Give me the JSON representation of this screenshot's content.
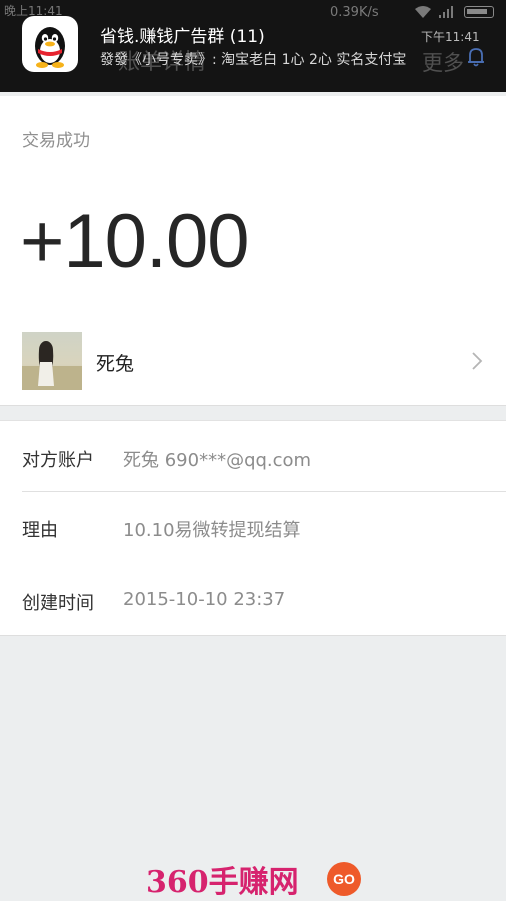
{
  "header": {
    "title": "账单详情",
    "more_label": "更多"
  },
  "statusbar": {
    "time": "晚上11:41",
    "network_speed": "0.39K/s"
  },
  "notification": {
    "app_icon": "qq-penguin-icon",
    "title": "省钱.赚钱广告群 (11)",
    "time": "下午11:41",
    "text": "發發《小号专卖》: 淘宝老白 1心 2心 实名支付宝"
  },
  "transaction": {
    "status": "交易成功",
    "amount": "+10.00",
    "user_name": "死兔"
  },
  "details": [
    {
      "label": "对方账户",
      "value": "死兔 690***@qq.com"
    },
    {
      "label": "理由",
      "value": "10.10易微转提现结算"
    },
    {
      "label": "创建时间",
      "value": "2015-10-10 23:37"
    }
  ],
  "watermark": {
    "text": "360手赚网",
    "badge": "GO"
  },
  "colors": {
    "accent_watermark": "#d6236e",
    "amount_text": "#262626",
    "label_grey": "#8f8f8f"
  }
}
